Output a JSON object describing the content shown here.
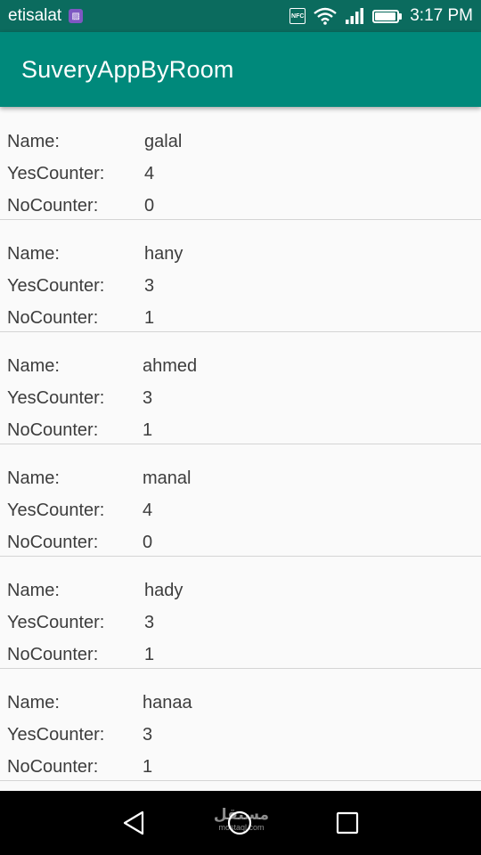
{
  "status_bar": {
    "carrier": "etisalat",
    "nfc_label": "NFC",
    "time": "3:17 PM",
    "battery_level": 0.95
  },
  "app_bar": {
    "title": "SuveryAppByRoom",
    "color": "#00897b"
  },
  "labels": {
    "name": "Name:",
    "yes": "YesCounter:",
    "no": "NoCounter:"
  },
  "records": [
    {
      "name": "galal",
      "yes": "4",
      "no": "0"
    },
    {
      "name": "hany",
      "yes": "3",
      "no": "1"
    },
    {
      "name": "ahmed",
      "yes": "3",
      "no": "1"
    },
    {
      "name": "manal",
      "yes": "4",
      "no": "0"
    },
    {
      "name": "hady",
      "yes": "3",
      "no": "1"
    },
    {
      "name": "hanaa",
      "yes": "3",
      "no": "1"
    }
  ],
  "nav_bar": {
    "back_icon": "back-triangle-icon",
    "home_icon": "home-circle-icon",
    "recents_icon": "recents-square-icon"
  },
  "watermark": {
    "main": "مستقل",
    "sub": "mostaql.com"
  }
}
